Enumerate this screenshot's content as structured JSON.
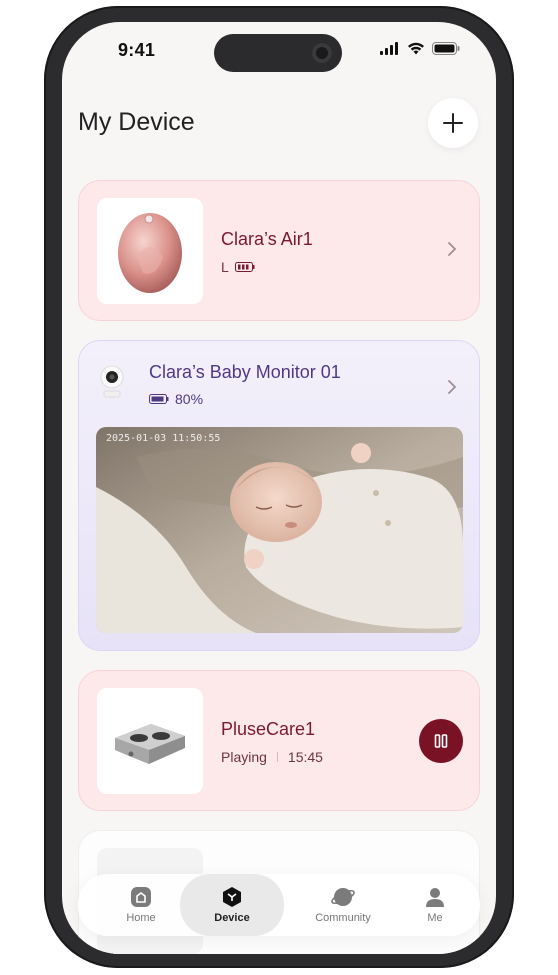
{
  "status_bar": {
    "time": "9:41"
  },
  "header": {
    "title": "My Device"
  },
  "devices": [
    {
      "name": "Clara’s Air1",
      "side": "L",
      "battery_icon": "battery-icon"
    },
    {
      "name": "Clara’s Baby Monitor 01",
      "battery": "80%",
      "timestamp": "2025-01-03 11:50:55"
    },
    {
      "name": "PluseCare1",
      "status": "Playing",
      "time": "15:45"
    }
  ],
  "tabs": [
    {
      "label": "Home",
      "icon": "home-icon"
    },
    {
      "label": "Device",
      "icon": "device-icon"
    },
    {
      "label": "Community",
      "icon": "planet-icon"
    },
    {
      "label": "Me",
      "icon": "person-icon"
    }
  ],
  "colors": {
    "accent": "#7a1225",
    "pink_card": "#fde8ea",
    "purple_card": "#ece8f8",
    "text_dark_red": "#7a1a2e",
    "purple_text": "#4d3a86"
  }
}
